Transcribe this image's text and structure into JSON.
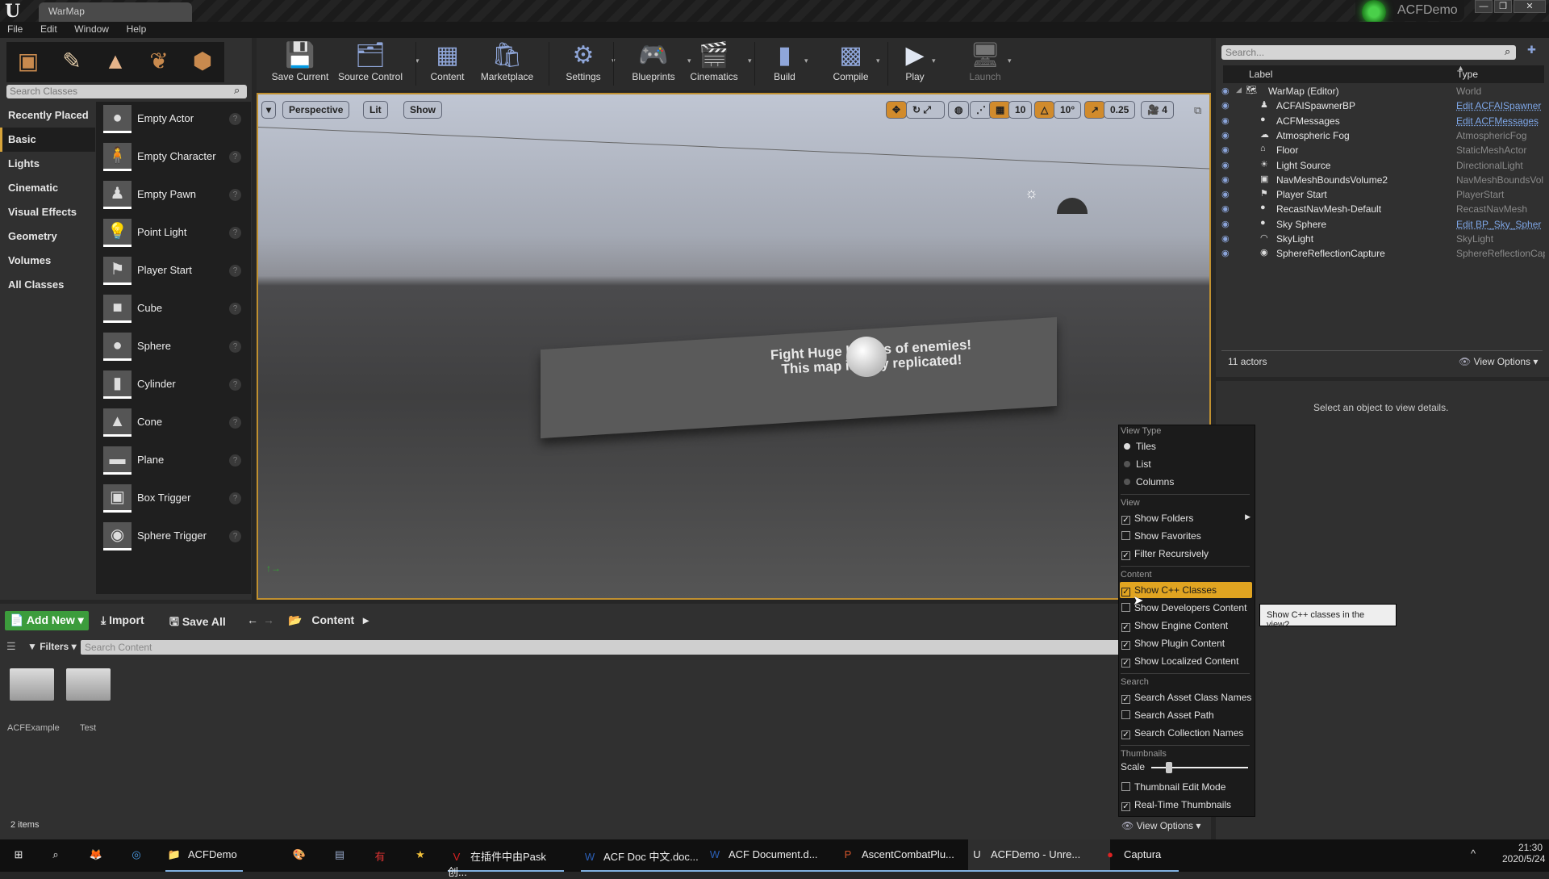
{
  "titlebar": {
    "tab": "WarMap",
    "project": "ACFDemo",
    "minimize": "—",
    "restore": "❐",
    "close": "✕"
  },
  "menu": [
    "File",
    "Edit",
    "Window",
    "Help"
  ],
  "modes": {
    "icons": [
      "place-mode-icon",
      "paint-mode-icon",
      "landscape-mode-icon",
      "foliage-mode-icon",
      "geometry-mode-icon"
    ],
    "search_placeholder": "Search Classes",
    "categories": [
      "Recently Placed",
      "Basic",
      "Lights",
      "Cinematic",
      "Visual Effects",
      "Geometry",
      "Volumes",
      "All Classes"
    ],
    "active_category": "Basic",
    "classes": [
      "Empty Actor",
      "Empty Character",
      "Empty Pawn",
      "Point Light",
      "Player Start",
      "Cube",
      "Sphere",
      "Cylinder",
      "Cone",
      "Plane",
      "Box Trigger",
      "Sphere Trigger"
    ]
  },
  "toolbar": {
    "buttons": [
      {
        "label": "Save Current",
        "icon": "💾",
        "dropdown": false
      },
      {
        "label": "Source Control",
        "icon": "🗂",
        "dropdown": true
      },
      {
        "label": "Content",
        "icon": "▦",
        "dropdown": false
      },
      {
        "label": "Marketplace",
        "icon": "🛍",
        "dropdown": false
      },
      {
        "label": "Settings",
        "icon": "⚙",
        "dropdown": true
      },
      {
        "label": "Blueprints",
        "icon": "🎮",
        "dropdown": true
      },
      {
        "label": "Cinematics",
        "icon": "🎬",
        "dropdown": true
      },
      {
        "label": "Build",
        "icon": "▮",
        "dropdown": true
      },
      {
        "label": "Compile",
        "icon": "▩",
        "dropdown": true
      },
      {
        "label": "Play",
        "icon": "▶",
        "dropdown": true
      },
      {
        "label": "Launch",
        "icon": "🖥",
        "dropdown": true
      }
    ]
  },
  "viewport": {
    "view_mode": "Perspective",
    "lighting": "Lit",
    "show": "Show",
    "grid_snap": "10",
    "rotation_snap": "10°",
    "scale_snap": "0.25",
    "camera_speed": "4",
    "wall_text_line1": "Fight Huge hordes of enemies!",
    "wall_text_line2": "This map is fully replicated!"
  },
  "outliner": {
    "search_placeholder": "Search...",
    "col_label": "Label",
    "col_type": "Type",
    "rows": [
      {
        "name": "WarMap (Editor)",
        "type": "World",
        "link": false,
        "icon": "🗺"
      },
      {
        "name": "ACFAISpawnerBP",
        "type": "Edit ACFAISpawner",
        "link": true,
        "icon": "♟"
      },
      {
        "name": "ACFMessages",
        "type": "Edit ACFMessages",
        "link": true,
        "icon": "●"
      },
      {
        "name": "Atmospheric Fog",
        "type": "AtmosphericFog",
        "link": false,
        "icon": "☁"
      },
      {
        "name": "Floor",
        "type": "StaticMeshActor",
        "link": false,
        "icon": "⌂"
      },
      {
        "name": "Light Source",
        "type": "DirectionalLight",
        "link": false,
        "icon": "☀"
      },
      {
        "name": "NavMeshBoundsVolume2",
        "type": "NavMeshBoundsVol",
        "link": false,
        "icon": "▣"
      },
      {
        "name": "Player Start",
        "type": "PlayerStart",
        "link": false,
        "icon": "⚑"
      },
      {
        "name": "RecastNavMesh-Default",
        "type": "RecastNavMesh",
        "link": false,
        "icon": "●"
      },
      {
        "name": "Sky Sphere",
        "type": "Edit BP_Sky_Spher",
        "link": true,
        "icon": "●"
      },
      {
        "name": "SkyLight",
        "type": "SkyLight",
        "link": false,
        "icon": "◠"
      },
      {
        "name": "SphereReflectionCapture",
        "type": "SphereReflectionCap",
        "link": false,
        "icon": "◉"
      }
    ],
    "count": "11 actors",
    "view_options": "View Options"
  },
  "details": {
    "empty_text": "Select an object to view details."
  },
  "content_browser": {
    "add_new": "Add New",
    "import": "Import",
    "save_all": "Save All",
    "path": "Content",
    "filters": "Filters",
    "search_placeholder": "Search Content",
    "folders": [
      "ACFExample",
      "Test"
    ],
    "item_count": "2 items",
    "view_options": "View Options"
  },
  "view_options_menu": {
    "sections": {
      "view_type": "View Type",
      "view": "View",
      "content": "Content",
      "search": "Search",
      "thumbnails": "Thumbnails"
    },
    "view_types": [
      {
        "label": "Tiles",
        "selected": true
      },
      {
        "label": "List",
        "selected": false
      },
      {
        "label": "Columns",
        "selected": false
      }
    ],
    "view_items": [
      {
        "label": "Show Folders",
        "checked": true
      },
      {
        "label": "Show Favorites",
        "checked": false
      },
      {
        "label": "Filter Recursively",
        "checked": true
      }
    ],
    "content_items": [
      {
        "label": "Show C++ Classes",
        "checked": true
      },
      {
        "label": "Show Developers Content",
        "checked": false
      },
      {
        "label": "Show Engine Content",
        "checked": true
      },
      {
        "label": "Show Plugin Content",
        "checked": true
      },
      {
        "label": "Show Localized Content",
        "checked": true
      }
    ],
    "search_items": [
      {
        "label": "Search Asset Class Names",
        "checked": true
      },
      {
        "label": "Search Asset Path",
        "checked": false
      },
      {
        "label": "Search Collection Names",
        "checked": true
      }
    ],
    "scale_label": "Scale",
    "scale_value": 0.15,
    "thumb_items": [
      {
        "label": "Thumbnail Edit Mode",
        "checked": false
      },
      {
        "label": "Real-Time Thumbnails",
        "checked": true
      }
    ],
    "highlighted": "Show C++ Classes",
    "tooltip": "Show C++ classes in the view?"
  },
  "taskbar": {
    "items": [
      {
        "label": "",
        "icon": "⊞"
      },
      {
        "label": "",
        "icon": "⌕"
      },
      {
        "label": "",
        "icon": "🦊"
      },
      {
        "label": "",
        "icon": "◎"
      },
      {
        "label": "ACFDemo",
        "icon": "📁"
      },
      {
        "label": "",
        "icon": "🎨"
      },
      {
        "label": "",
        "icon": "▤"
      },
      {
        "label": "",
        "icon": "有"
      },
      {
        "label": "",
        "icon": "★"
      },
      {
        "label": "在插件中由Pask创...",
        "icon": "V"
      },
      {
        "label": "ACF Doc 中文.doc...",
        "icon": "W"
      },
      {
        "label": "ACF Document.d...",
        "icon": "W"
      },
      {
        "label": "AscentCombatPlu...",
        "icon": "P"
      },
      {
        "label": "ACFDemo - Unre...",
        "icon": "U"
      },
      {
        "label": "Captura",
        "icon": "●"
      }
    ],
    "time": "21:30",
    "date": "2020/5/24"
  }
}
